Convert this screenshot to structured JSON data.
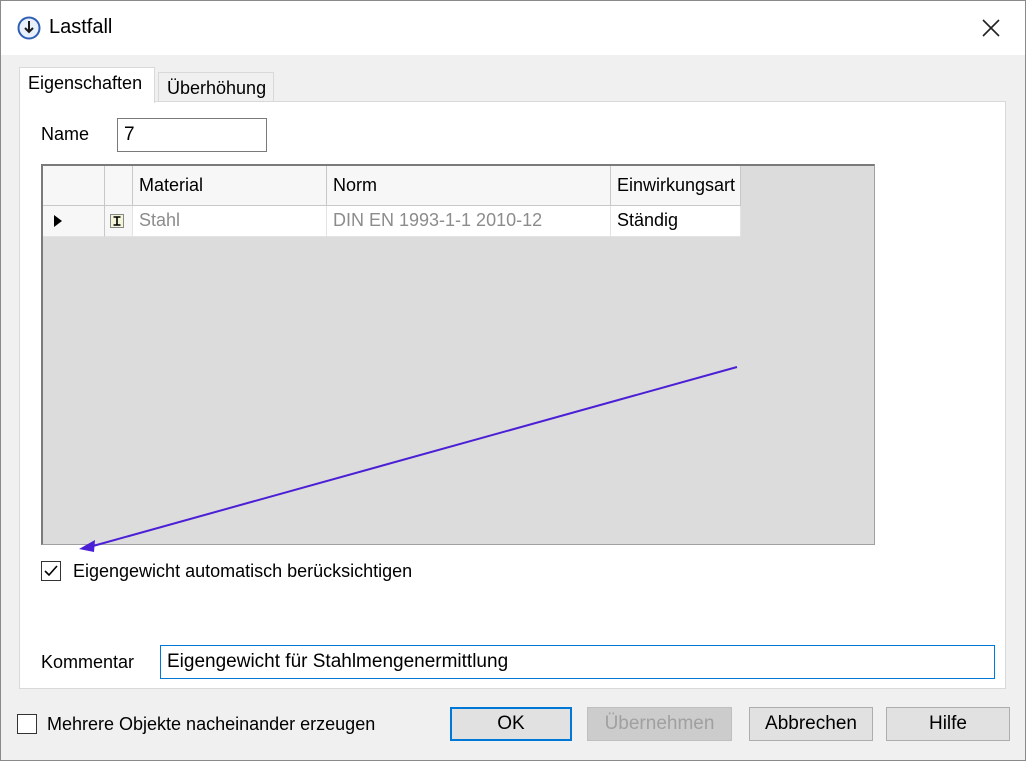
{
  "window": {
    "title": "Lastfall"
  },
  "tabs": [
    {
      "label": "Eigenschaften"
    },
    {
      "label": "Überhöhung"
    }
  ],
  "name_field": {
    "label": "Name",
    "value": "7"
  },
  "grid": {
    "columns": [
      "Material",
      "Norm",
      "Einwirkungsart"
    ],
    "rows": [
      {
        "material": "Stahl",
        "norm": "DIN EN 1993-1-1 2010-12",
        "einwirkungsart": "Ständig"
      }
    ]
  },
  "auto_weight_checkbox": {
    "label": "Eigengewicht automatisch berücksichtigen",
    "checked": true
  },
  "comment_field": {
    "label": "Kommentar",
    "value": "Eigengewicht für Stahlmengenermittlung"
  },
  "multi_create_checkbox": {
    "label": "Mehrere Objekte nacheinander erzeugen",
    "checked": false
  },
  "buttons": {
    "ok": "OK",
    "apply": "Übernehmen",
    "cancel": "Abbrechen",
    "help": "Hilfe"
  },
  "colors": {
    "annotation_arrow": "#4b1fd6",
    "default_button_border": "#0078d7",
    "focus_border": "#0078d7"
  }
}
